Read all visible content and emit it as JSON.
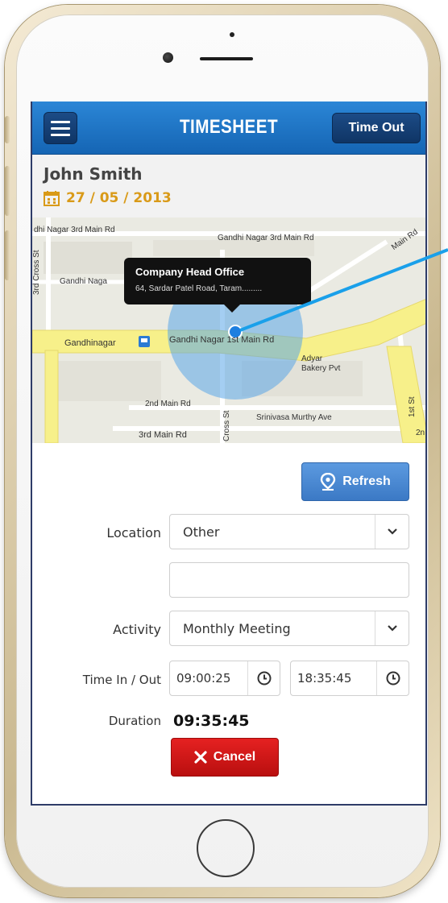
{
  "app": {
    "title": "TIMESHEET",
    "time_out_label": "Time Out"
  },
  "user": {
    "name": "John Smith",
    "date": "27 / 05 / 2013"
  },
  "map": {
    "tooltip_title": "Company Head Office",
    "tooltip_address": "64, Sardar Patel Road, Taram.........",
    "labels": {
      "gandhi_nagar_3rd_main_left": "dhi Nagar 3rd Main Rd",
      "gandhi_nagar_3rd_main_right": "Gandhi Nagar 3rd Main Rd",
      "gandhi_naga": "Gandhi Naga",
      "third_cross": "3rd Cross St",
      "gandhinagar": "Gandhinagar",
      "gandhi_nagar_1st_main": "Gandhi Nagar 1st Main Rd",
      "adyar_bakery": "Adyar\nBakery Pvt",
      "second_main": "2nd Main Rd",
      "srinivasa": "Srinivasa Murthy Ave",
      "third_main": "3rd Main Rd",
      "cross_st": "Cross St",
      "first_st": "1st St",
      "main_rd_right": "Main Rd",
      "two_n": "2n"
    },
    "colors": {
      "road": "#f7f08a",
      "land": "#eaeae2",
      "accuracy": "#5aa6e8",
      "marker": "#1e7fe0"
    }
  },
  "form": {
    "refresh_label": "Refresh",
    "location_label": "Location",
    "location_value": "Other",
    "location_extra_value": "",
    "activity_label": "Activity",
    "activity_value": "Monthly Meeting",
    "time_label": "Time In / Out",
    "time_in": "09:00:25",
    "time_out": "18:35:45",
    "duration_label": "Duration",
    "duration_value": "09:35:45",
    "cancel_label": "Cancel"
  },
  "colors": {
    "header_blue": "#1a6fc0",
    "date_orange": "#d99a18",
    "refresh_blue": "#4a89d4",
    "cancel_red": "#d01818"
  }
}
